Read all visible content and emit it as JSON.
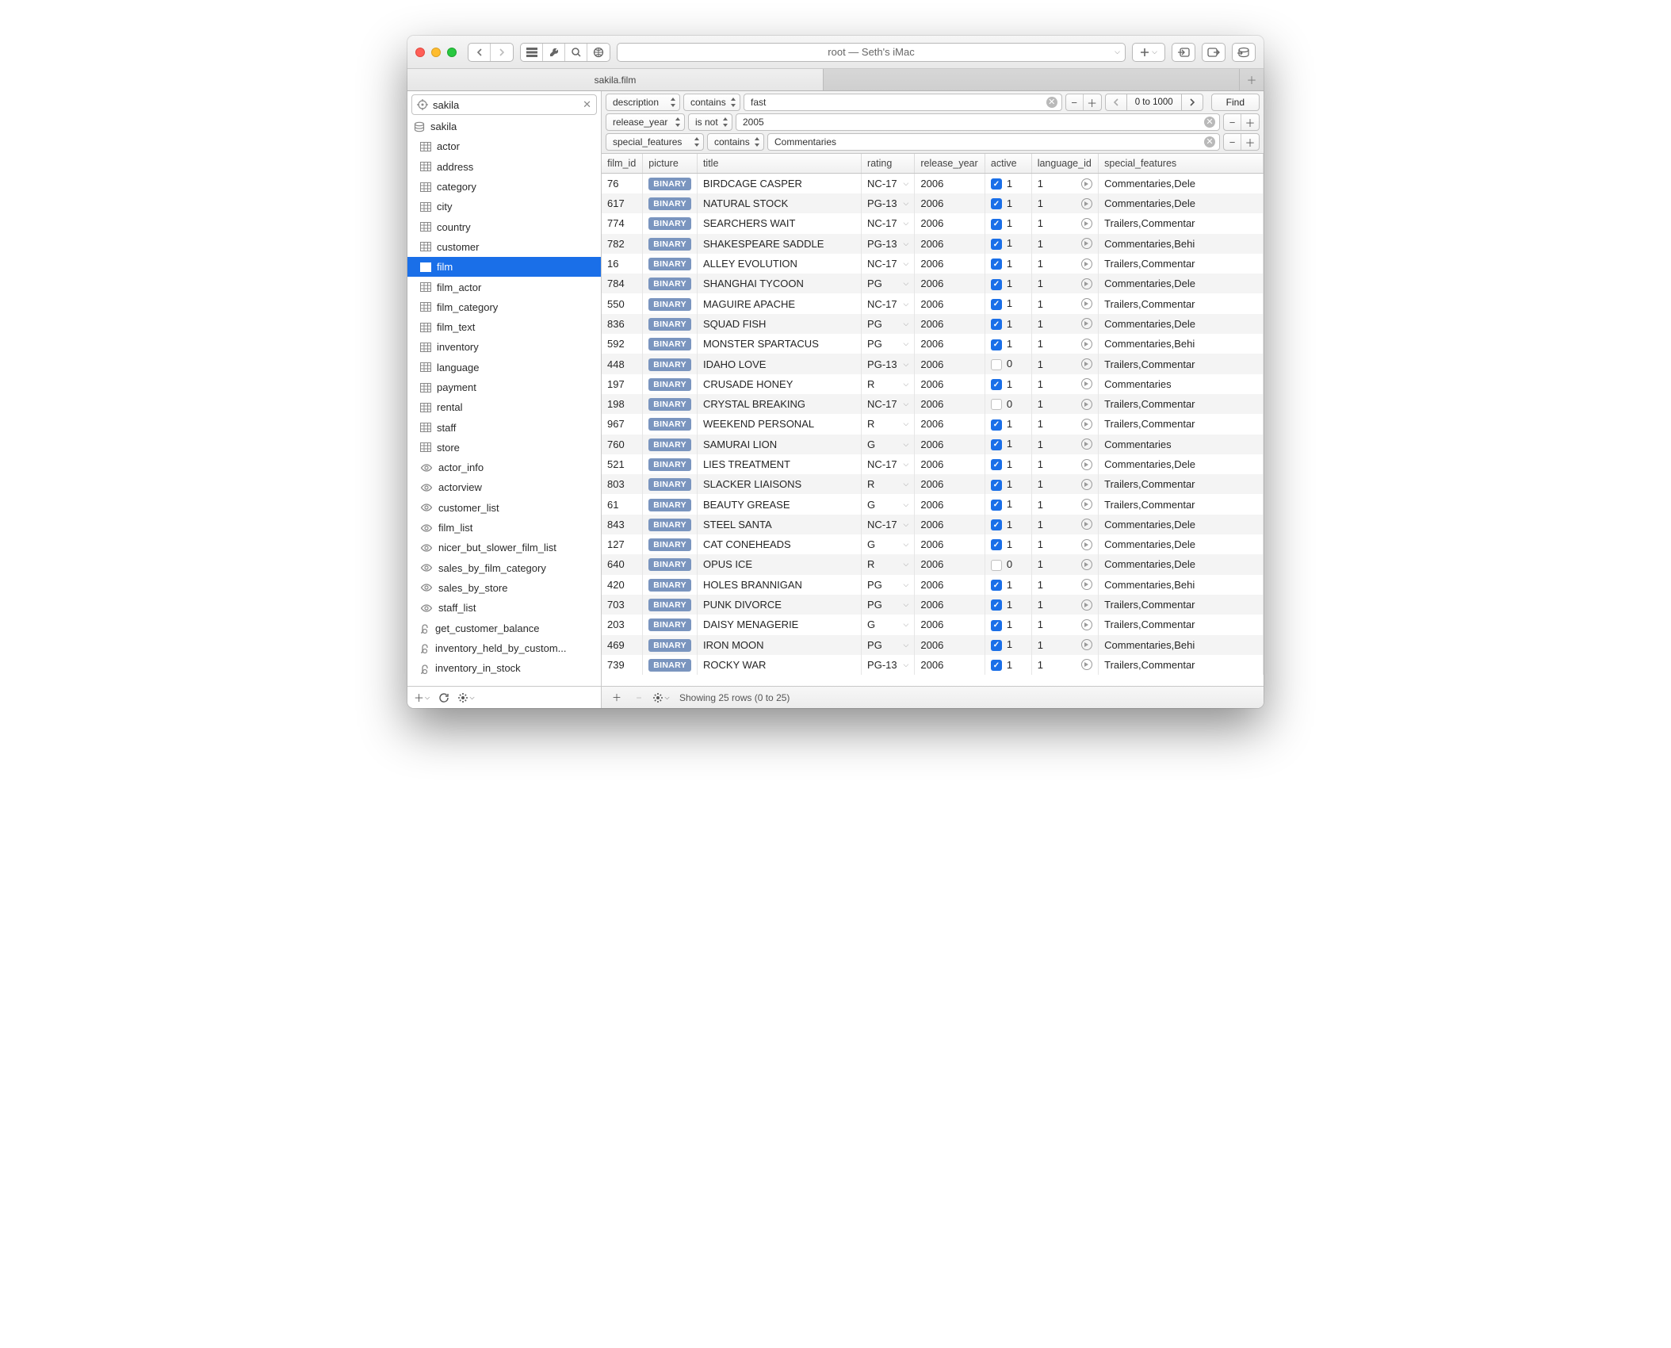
{
  "titlebar": {
    "connection": "root — Seth's iMac"
  },
  "tab": {
    "label": "sakila.film"
  },
  "sidebar": {
    "db_name": "sakila",
    "items": [
      {
        "icon": "db",
        "label": "sakila"
      },
      {
        "icon": "table",
        "label": "actor"
      },
      {
        "icon": "table",
        "label": "address"
      },
      {
        "icon": "table",
        "label": "category"
      },
      {
        "icon": "table",
        "label": "city"
      },
      {
        "icon": "table",
        "label": "country"
      },
      {
        "icon": "table",
        "label": "customer"
      },
      {
        "icon": "table",
        "label": "film",
        "selected": true
      },
      {
        "icon": "table",
        "label": "film_actor"
      },
      {
        "icon": "table",
        "label": "film_category"
      },
      {
        "icon": "table",
        "label": "film_text"
      },
      {
        "icon": "table",
        "label": "inventory"
      },
      {
        "icon": "table",
        "label": "language"
      },
      {
        "icon": "table",
        "label": "payment"
      },
      {
        "icon": "table",
        "label": "rental"
      },
      {
        "icon": "table",
        "label": "staff"
      },
      {
        "icon": "table",
        "label": "store"
      },
      {
        "icon": "view",
        "label": "actor_info"
      },
      {
        "icon": "view",
        "label": "actorview"
      },
      {
        "icon": "view",
        "label": "customer_list"
      },
      {
        "icon": "view",
        "label": "film_list"
      },
      {
        "icon": "view",
        "label": "nicer_but_slower_film_list"
      },
      {
        "icon": "view",
        "label": "sales_by_film_category"
      },
      {
        "icon": "view",
        "label": "sales_by_store"
      },
      {
        "icon": "view",
        "label": "staff_list"
      },
      {
        "icon": "func",
        "label": "get_customer_balance"
      },
      {
        "icon": "func",
        "label": "inventory_held_by_custom..."
      },
      {
        "icon": "func",
        "label": "inventory_in_stock"
      }
    ]
  },
  "filters": {
    "rows": [
      {
        "field": "description",
        "op": "contains",
        "value": "fast"
      },
      {
        "field": "release_year",
        "op": "is not",
        "value": "2005"
      },
      {
        "field": "special_features",
        "op": "contains",
        "value": "Commentaries"
      }
    ],
    "range": "0 to 1000",
    "find": "Find"
  },
  "columns": [
    "film_id",
    "picture",
    "title",
    "rating",
    "release_year",
    "active",
    "language_id",
    "special_features"
  ],
  "binary_label": "BINARY",
  "rows": [
    {
      "id": "76",
      "title": "BIRDCAGE CASPER",
      "rating": "NC-17",
      "year": "2006",
      "active": 1,
      "lang": "1",
      "feat": "Commentaries,Dele"
    },
    {
      "id": "617",
      "title": "NATURAL STOCK",
      "rating": "PG-13",
      "year": "2006",
      "active": 1,
      "lang": "1",
      "feat": "Commentaries,Dele"
    },
    {
      "id": "774",
      "title": "SEARCHERS WAIT",
      "rating": "NC-17",
      "year": "2006",
      "active": 1,
      "lang": "1",
      "feat": "Trailers,Commentar"
    },
    {
      "id": "782",
      "title": "SHAKESPEARE SADDLE",
      "rating": "PG-13",
      "year": "2006",
      "active": 1,
      "lang": "1",
      "feat": "Commentaries,Behi"
    },
    {
      "id": "16",
      "title": "ALLEY EVOLUTION",
      "rating": "NC-17",
      "year": "2006",
      "active": 1,
      "lang": "1",
      "feat": "Trailers,Commentar"
    },
    {
      "id": "784",
      "title": "SHANGHAI TYCOON",
      "rating": "PG",
      "year": "2006",
      "active": 1,
      "lang": "1",
      "feat": "Commentaries,Dele"
    },
    {
      "id": "550",
      "title": "MAGUIRE APACHE",
      "rating": "NC-17",
      "year": "2006",
      "active": 1,
      "lang": "1",
      "feat": "Trailers,Commentar"
    },
    {
      "id": "836",
      "title": "SQUAD FISH",
      "rating": "PG",
      "year": "2006",
      "active": 1,
      "lang": "1",
      "feat": "Commentaries,Dele"
    },
    {
      "id": "592",
      "title": "MONSTER SPARTACUS",
      "rating": "PG",
      "year": "2006",
      "active": 1,
      "lang": "1",
      "feat": "Commentaries,Behi"
    },
    {
      "id": "448",
      "title": "IDAHO LOVE",
      "rating": "PG-13",
      "year": "2006",
      "active": 0,
      "lang": "1",
      "feat": "Trailers,Commentar"
    },
    {
      "id": "197",
      "title": "CRUSADE HONEY",
      "rating": "R",
      "year": "2006",
      "active": 1,
      "lang": "1",
      "feat": "Commentaries"
    },
    {
      "id": "198",
      "title": "CRYSTAL BREAKING",
      "rating": "NC-17",
      "year": "2006",
      "active": 0,
      "lang": "1",
      "feat": "Trailers,Commentar"
    },
    {
      "id": "967",
      "title": "WEEKEND PERSONAL",
      "rating": "R",
      "year": "2006",
      "active": 1,
      "lang": "1",
      "feat": "Trailers,Commentar"
    },
    {
      "id": "760",
      "title": "SAMURAI LION",
      "rating": "G",
      "year": "2006",
      "active": 1,
      "lang": "1",
      "feat": "Commentaries"
    },
    {
      "id": "521",
      "title": "LIES TREATMENT",
      "rating": "NC-17",
      "year": "2006",
      "active": 1,
      "lang": "1",
      "feat": "Commentaries,Dele"
    },
    {
      "id": "803",
      "title": "SLACKER LIAISONS",
      "rating": "R",
      "year": "2006",
      "active": 1,
      "lang": "1",
      "feat": "Trailers,Commentar"
    },
    {
      "id": "61",
      "title": "BEAUTY GREASE",
      "rating": "G",
      "year": "2006",
      "active": 1,
      "lang": "1",
      "feat": "Trailers,Commentar"
    },
    {
      "id": "843",
      "title": "STEEL SANTA",
      "rating": "NC-17",
      "year": "2006",
      "active": 1,
      "lang": "1",
      "feat": "Commentaries,Dele"
    },
    {
      "id": "127",
      "title": "CAT CONEHEADS",
      "rating": "G",
      "year": "2006",
      "active": 1,
      "lang": "1",
      "feat": "Commentaries,Dele"
    },
    {
      "id": "640",
      "title": "OPUS ICE",
      "rating": "R",
      "year": "2006",
      "active": 0,
      "lang": "1",
      "feat": "Commentaries,Dele"
    },
    {
      "id": "420",
      "title": "HOLES BRANNIGAN",
      "rating": "PG",
      "year": "2006",
      "active": 1,
      "lang": "1",
      "feat": "Commentaries,Behi"
    },
    {
      "id": "703",
      "title": "PUNK DIVORCE",
      "rating": "PG",
      "year": "2006",
      "active": 1,
      "lang": "1",
      "feat": "Trailers,Commentar"
    },
    {
      "id": "203",
      "title": "DAISY MENAGERIE",
      "rating": "G",
      "year": "2006",
      "active": 1,
      "lang": "1",
      "feat": "Trailers,Commentar"
    },
    {
      "id": "469",
      "title": "IRON MOON",
      "rating": "PG",
      "year": "2006",
      "active": 1,
      "lang": "1",
      "feat": "Commentaries,Behi"
    },
    {
      "id": "739",
      "title": "ROCKY WAR",
      "rating": "PG-13",
      "year": "2006",
      "active": 1,
      "lang": "1",
      "feat": "Trailers,Commentar"
    }
  ],
  "footer": {
    "status": "Showing 25 rows (0 to 25)"
  }
}
